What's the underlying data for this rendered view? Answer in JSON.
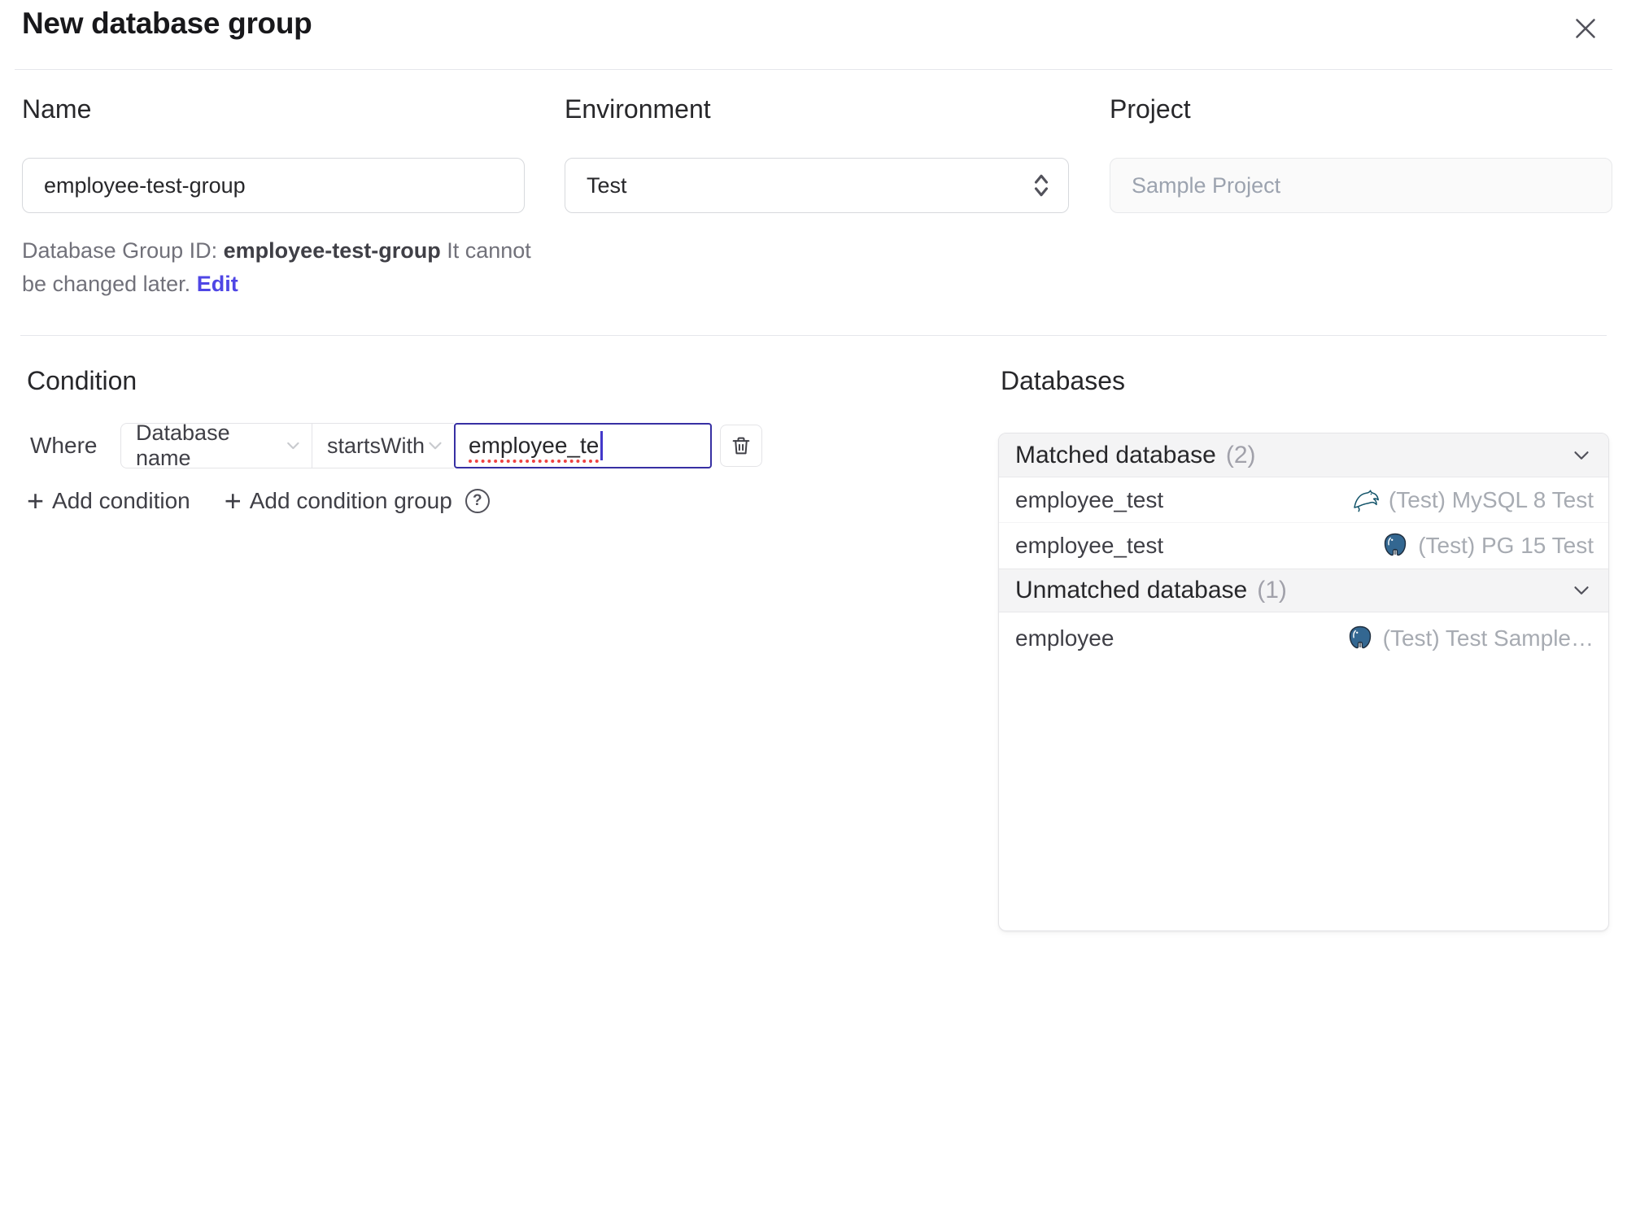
{
  "dialog": {
    "title": "New database group"
  },
  "form": {
    "name": {
      "label": "Name",
      "value": "employee-test-group"
    },
    "environment": {
      "label": "Environment",
      "value": "Test"
    },
    "project": {
      "label": "Project",
      "value": "Sample Project"
    },
    "id_hint": {
      "prefix": "Database Group ID:",
      "id": "employee-test-group",
      "suffix": "It cannot be changed later.",
      "edit_label": "Edit"
    }
  },
  "condition": {
    "heading": "Condition",
    "where_label": "Where",
    "field_selected": "Database name",
    "operator_selected": "startsWith",
    "value": "employee_te",
    "add_condition_label": "Add condition",
    "add_condition_group_label": "Add condition group"
  },
  "databases": {
    "heading": "Databases",
    "matched": {
      "label": "Matched database",
      "count": "(2)",
      "rows": [
        {
          "name": "employee_test",
          "engine": "mysql",
          "instance": "(Test) MySQL 8 Test"
        },
        {
          "name": "employee_test",
          "engine": "postgres",
          "instance": "(Test) PG 15 Test"
        }
      ]
    },
    "unmatched": {
      "label": "Unmatched database",
      "count": "(1)",
      "rows": [
        {
          "name": "employee",
          "engine": "postgres",
          "instance": "(Test) Test Sample…"
        }
      ]
    }
  },
  "icons": {
    "plus": "+",
    "help": "?"
  },
  "colors": {
    "accent_link": "#4f46e5",
    "focus_border": "#3730a3",
    "spellcheck_underline": "#ef4444",
    "panel_header_bg": "#f4f4f5",
    "muted_text": "#a7abb2",
    "mysql_icon": "#13546a",
    "postgres_icon": "#336791"
  }
}
